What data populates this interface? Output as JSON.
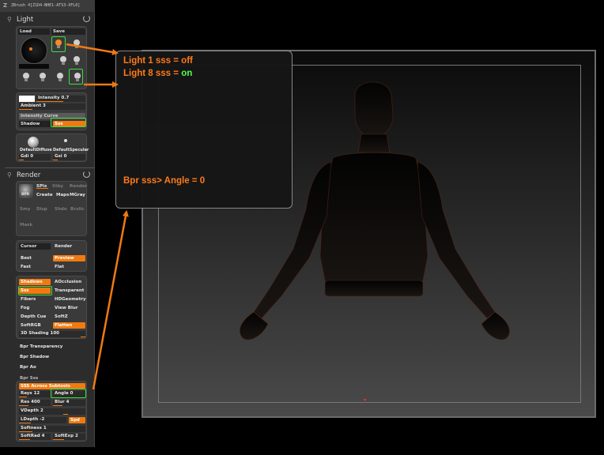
{
  "palette": {
    "title": "ZBrush 4[Z1D4-NHE1-ATS3-XFL0]",
    "logo": "Z",
    "light_section": {
      "title": "Light",
      "load_label": "Load",
      "save_label": "Save",
      "intensity": {
        "label": "Intensity",
        "value": "0.7",
        "fraction": 0.55
      },
      "ambient": {
        "label": "Ambient",
        "value": "3",
        "fraction": 0.2
      },
      "intensity_curve_label": "Intensity Curve",
      "shadow_label": "Shadow",
      "sss_label": "Sss",
      "default_diffuse_label": "DefaultDiffuse",
      "default_specular_label": "DefaultSpecular",
      "gdi": {
        "label": "Gdi",
        "value": "0"
      },
      "gsi": {
        "label": "Gsi",
        "value": "0"
      }
    },
    "render_section": {
      "title": "Render",
      "bpr_label": "BPR",
      "spix_label": "SPix",
      "create_label": "Create",
      "maps_label": "Maps",
      "mgray_label": "MGray",
      "dim_row1": [
        "Stby",
        "Redpr",
        "Render"
      ],
      "dim_row2": [
        "Smy",
        "Disp",
        "Shdo",
        "Bcslic"
      ],
      "dim_row3": [
        "Mask"
      ],
      "cursor_label": "Cursor",
      "render_label": "Render",
      "best_label": "Best",
      "preview_label": "Preview",
      "fast_label": "Fast",
      "flat_label": "Flat",
      "shadows_label": "Shadows",
      "aocclusion_label": "AOcclusion",
      "sss_label": "Sss",
      "transparent_label": "Transparent",
      "fibers_label": "Fibers",
      "hdgeometry_label": "HDGeometry",
      "fog_label": "Fog",
      "viewblur_label": "View Blur",
      "depthcue_label": "Depth Cue",
      "softz_label": "SoftZ",
      "softrgb_label": "SoftRGB",
      "flatten_label": "Flatten",
      "shading": {
        "label": "3D Shading",
        "value": "100"
      },
      "bpr_transparency_label": "Bpr Transparency",
      "bpr_shadow_label": "Bpr Shadow",
      "bpr_ao_label": "Bpr Ao",
      "bpr_sss_label": "Bpr Sss",
      "sss_across_label": "SSS Across Subtools",
      "rays": {
        "label": "Rays",
        "value": "12"
      },
      "angle": {
        "label": "Angle",
        "value": "0"
      },
      "res": {
        "label": "Res",
        "value": "400"
      },
      "blur": {
        "label": "Blur",
        "value": "4"
      },
      "vdepth": {
        "label": "VDepth",
        "value": "2"
      },
      "ldepth": {
        "label": "LDepth",
        "value": "-2"
      },
      "spd_label": "Spd",
      "softness": {
        "label": "Softness",
        "value": "1"
      },
      "softrad": {
        "label": "SoftRad",
        "value": "4"
      },
      "softexp": {
        "label": "SoftExp",
        "value": "2"
      }
    }
  },
  "callout": {
    "light1_text": "Light 1 sss = off",
    "light8_prefix": "Light 8 sss = ",
    "light8_state": "on",
    "bpr_text": "Bpr sss> Angle = 0"
  },
  "colors": {
    "accent": "#f07a12",
    "highlight_box": "#3ddf3d",
    "callout_text": "#ff7a1a",
    "on_text": "#4dff4d"
  }
}
